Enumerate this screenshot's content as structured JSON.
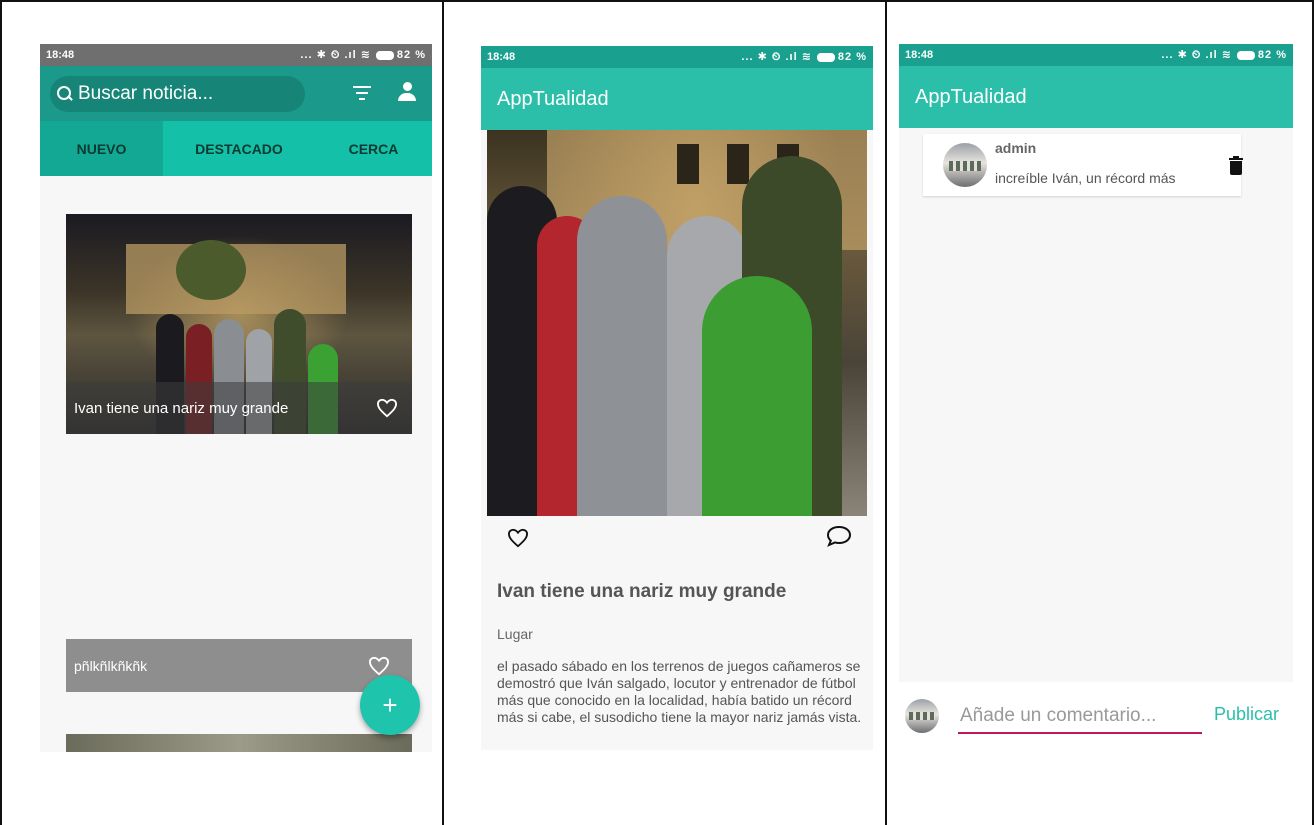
{
  "screen1": {
    "status": {
      "time": "18:48",
      "icons": "... ✱ ⏲ .ıl ≋",
      "battery": "82 %"
    },
    "search": {
      "placeholder": "Buscar noticia..."
    },
    "icons": {
      "search": "search-icon",
      "filter": "filter-icon",
      "user": "user-icon"
    },
    "tabs": [
      {
        "label": "NUEVO",
        "active": true
      },
      {
        "label": "DESTACADO",
        "active": false
      },
      {
        "label": "CERCA",
        "active": false
      }
    ],
    "cards": [
      {
        "caption": "Ivan tiene una nariz muy grande"
      },
      {
        "caption": "pñlkñlkñkñk"
      }
    ],
    "fab_label": "+"
  },
  "screen2": {
    "status": {
      "time": "18:48",
      "icons": "... ✱ ⏲ .ıl ≋",
      "battery": "82 %"
    },
    "app_title": "AppTualidad",
    "article": {
      "title": "Ivan tiene una nariz muy grande",
      "place": "Lugar",
      "body": "el pasado sábado en los terrenos de juegos cañameros se demostró que Iván salgado, locutor y entrenador de fútbol más que conocido en la localidad, había batido un récord más si cabe, el susodicho tiene la mayor nariz jamás vista."
    }
  },
  "screen3": {
    "status": {
      "time": "18:48",
      "icons": "... ✱ ⏲ .ıl ≋",
      "battery": "82 %"
    },
    "app_title": "AppTualidad",
    "comments": [
      {
        "user": "admin",
        "text": "increíble Iván, un récord más"
      }
    ],
    "input_placeholder": "Añade un comentario...",
    "publish_label": "Publicar"
  },
  "colors": {
    "primary": "#2bbfaa",
    "primary_dark": "#1aa08e",
    "tab_bar": "#14c0a7",
    "accent_underline": "#c2185b"
  }
}
